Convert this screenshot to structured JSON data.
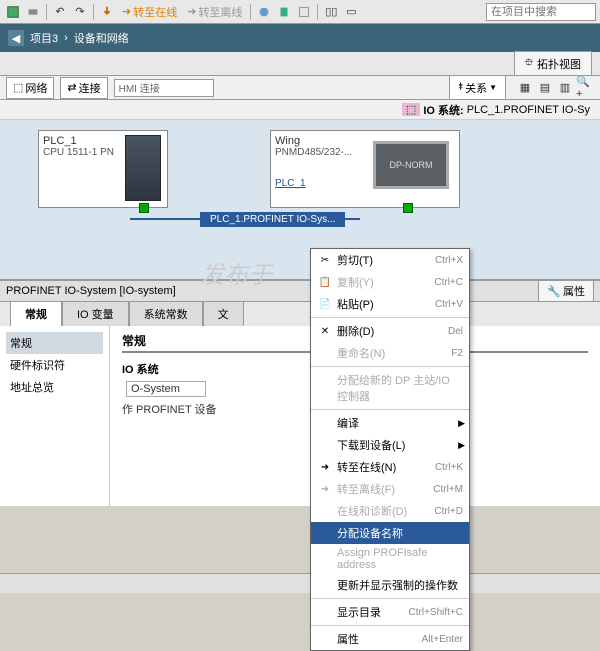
{
  "toolbar": {
    "go_online": "转至在线",
    "go_offline": "转至离线",
    "search_placeholder": "在项目中搜索"
  },
  "breadcrumb": {
    "project": "项目3",
    "sep": "›",
    "page": "设备和网络"
  },
  "topo_button": "拓扑视图",
  "net_toolbar": {
    "network": "网络",
    "connect": "连接",
    "hmi": "HMI 连接",
    "relations": "关系"
  },
  "system_label": {
    "prefix": "IO 系统:",
    "value": "PLC_1.PROFINET IO-Sy"
  },
  "devices": {
    "plc": {
      "name": "PLC_1",
      "type": "CPU 1511-1 PN"
    },
    "wing": {
      "name": "Wing",
      "type": "PNMD485/232-...",
      "link": "PLC_1",
      "dp": "DP-NORM"
    },
    "net_label": "PLC_1.PROFINET IO-Sys..."
  },
  "props_header": "PROFINET IO-System [IO-system]",
  "prop_tabs": {
    "properties": "属性"
  },
  "tabs": [
    "常规",
    "IO 变量",
    "系统常数",
    "文"
  ],
  "nav": [
    "常规",
    "硬件标识符",
    "地址总览"
  ],
  "props_main": {
    "heading": "常规",
    "sub": "IO 系统",
    "field1_val": "O-System",
    "field2_label": "作 PROFINET 设备"
  },
  "context_menu": [
    {
      "icon": "✂",
      "label": "剪切(T)",
      "shortcut": "Ctrl+X"
    },
    {
      "icon": "📋",
      "label": "复制(Y)",
      "shortcut": "Ctrl+C",
      "disabled": true
    },
    {
      "icon": "📄",
      "label": "粘贴(P)",
      "shortcut": "Ctrl+V"
    },
    {
      "sep": true
    },
    {
      "icon": "✕",
      "label": "删除(D)",
      "shortcut": "Del"
    },
    {
      "icon": "",
      "label": "重命名(N)",
      "shortcut": "F2",
      "disabled": true
    },
    {
      "sep": true
    },
    {
      "icon": "",
      "label": "分配给新的 DP 主站/IO 控制器",
      "disabled": true
    },
    {
      "sep": true
    },
    {
      "icon": "",
      "label": "编译",
      "sub": true
    },
    {
      "icon": "",
      "label": "下载到设备(L)",
      "sub": true
    },
    {
      "icon": "➜",
      "label": "转至在线(N)",
      "shortcut": "Ctrl+K"
    },
    {
      "icon": "➜",
      "label": "转至离线(F)",
      "shortcut": "Ctrl+M",
      "disabled": true
    },
    {
      "icon": "",
      "label": "在线和诊断(D)",
      "shortcut": "Ctrl+D",
      "disabled": true
    },
    {
      "icon": "",
      "label": "分配设备名称",
      "highlight": true
    },
    {
      "icon": "",
      "label": "Assign PROFIsafe address",
      "disabled": true
    },
    {
      "icon": "",
      "label": "更新并显示强制的操作数"
    },
    {
      "sep": true
    },
    {
      "icon": "",
      "label": "显示目录",
      "shortcut": "Ctrl+Shift+C"
    },
    {
      "sep": true
    },
    {
      "icon": "",
      "label": "属性",
      "shortcut": "Alt+Enter"
    }
  ]
}
